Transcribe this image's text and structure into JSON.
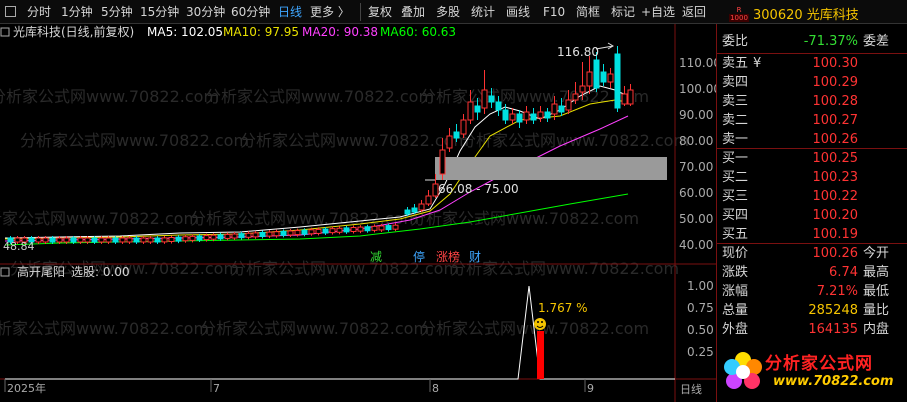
{
  "toolbar": {
    "periods": [
      "分时",
      "1分钟",
      "5分钟",
      "15分钟",
      "30分钟",
      "60分钟",
      "日线",
      "更多 〉"
    ],
    "active_period": "日线",
    "tools": [
      "复权",
      "叠加",
      "多股",
      "统计",
      "画线",
      "F10",
      "简框",
      "标记",
      "+自选",
      "返回"
    ]
  },
  "chart": {
    "title": "光库科技(日线,前复权)",
    "ma5": "MA5: 102.05",
    "ma10": "MA10: 97.95",
    "ma20": "MA20: 90.38",
    "ma60": "MA60: 60.63",
    "high_label": "116.80",
    "zone_label": "66.08 - 75.00",
    "low_label": "48.84",
    "y_ticks": [
      "110.00",
      "100.00",
      "90.00",
      "80.00",
      "70.00",
      "60.00",
      "50.00",
      "40.00"
    ],
    "event_tags": [
      "减",
      "停",
      "涨榜",
      "财"
    ],
    "watermark": "分析家公式网www.70822.com"
  },
  "indicator": {
    "name": "高开尾阳",
    "stock_label": "选股: 0.00",
    "percent_label": "1.767 %",
    "y_ticks": [
      "1.00",
      "0.75",
      "0.50",
      "0.25"
    ]
  },
  "axis": {
    "year": "2025年",
    "months": [
      "7",
      "8",
      "9"
    ],
    "right_label": "日线"
  },
  "quote": {
    "code": "300620",
    "name": "光库科技",
    "badge_top": "R",
    "badge_bottom": "1000",
    "webi_label": "委比",
    "webi_value": "-71.37%",
    "weicha_label": "委差",
    "asks": [
      {
        "label": "卖五",
        "mark": "¥",
        "price": "100.30"
      },
      {
        "label": "卖四",
        "mark": "",
        "price": "100.29"
      },
      {
        "label": "卖三",
        "mark": "",
        "price": "100.28"
      },
      {
        "label": "卖二",
        "mark": "",
        "price": "100.27"
      },
      {
        "label": "卖一",
        "mark": "",
        "price": "100.26"
      }
    ],
    "bids": [
      {
        "label": "买一",
        "price": "100.25"
      },
      {
        "label": "买二",
        "price": "100.23"
      },
      {
        "label": "买三",
        "price": "100.22"
      },
      {
        "label": "买四",
        "price": "100.20"
      },
      {
        "label": "买五",
        "price": "100.19"
      }
    ],
    "stats": [
      {
        "label": "现价",
        "value": "100.26",
        "extra": "今开"
      },
      {
        "label": "涨跌",
        "value": "6.74",
        "extra": "最高"
      },
      {
        "label": "涨幅",
        "value": "7.21%",
        "extra": "最低"
      },
      {
        "label": "总量",
        "value": "285248",
        "extra": "量比"
      },
      {
        "label": "外盘",
        "value": "164135",
        "extra": "内盘"
      }
    ]
  },
  "logo": {
    "name": "分析家公式网",
    "url": "www.70822.com"
  },
  "colors": {
    "up": "#ff3333",
    "down": "#00e0e0",
    "ma5": "#ffffff",
    "ma10": "#e8e000",
    "ma20": "#ff40ff",
    "ma60": "#00ff00"
  }
}
